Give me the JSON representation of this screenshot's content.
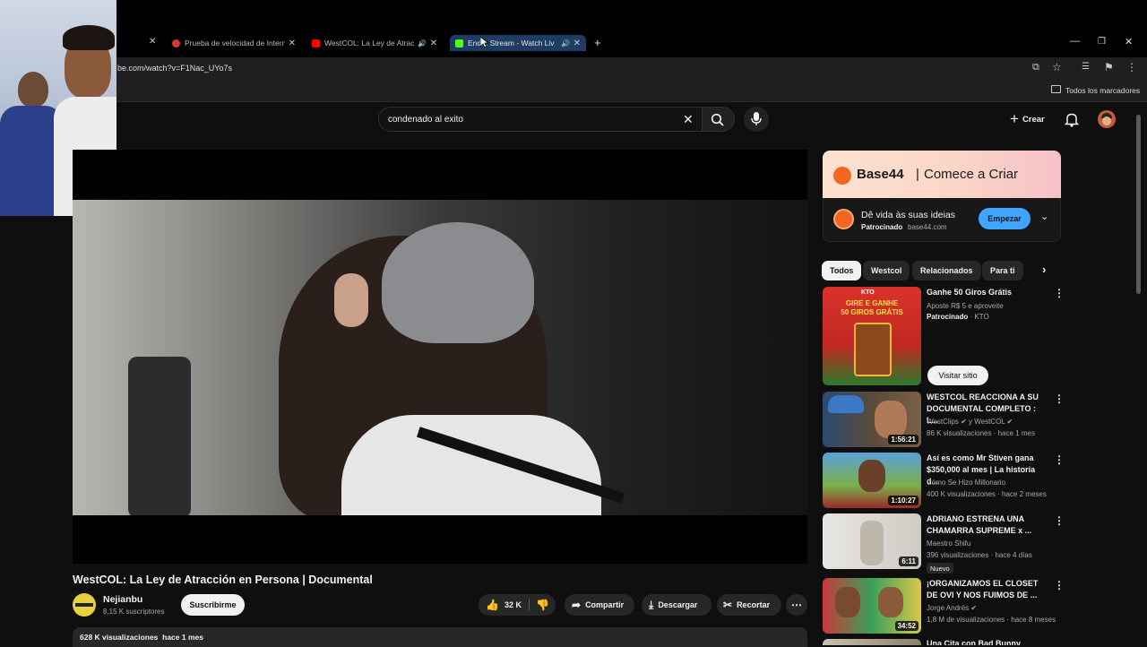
{
  "browser": {
    "tabs": [
      {
        "title": "Prueba de velocidad de Interne",
        "favicon_color": "#d93636"
      },
      {
        "title": "WestCOL: La Ley de Atracci",
        "favicon_color": "#ff0000"
      },
      {
        "title": "End... Stream - Watch Liv",
        "favicon_color": "#53fc18"
      }
    ],
    "new_tab_label": "+",
    "url": "be.com/watch?v=F1Nac_UYo7s",
    "bookmarks_label": "Todos los marcadores"
  },
  "header": {
    "search_value": "condenado al exito",
    "create_label": "Crear"
  },
  "video": {
    "title": "WestCOL: La Ley de Atracción en Persona | Documental",
    "channel": "Nejianbu",
    "subscribers": "8,15 K suscriptores",
    "subscribe_label": "Suscribirme",
    "likes": "32 K",
    "share_label": "Compartir",
    "download_label": "Descargar",
    "clip_label": "Recortar",
    "views_line": "628 K visualizaciones  hace 1 mes"
  },
  "ad": {
    "banner_text": "Base 44 | Comece a Criar",
    "brand": "Base44",
    "tagline": "Comece a Criar",
    "headline": "Dê vida às suas ideias",
    "sponsor_prefix": "Patrocinado",
    "domain": "base44.com",
    "cta": "Empezar",
    "accent": "#f26522"
  },
  "chips": [
    "Todos",
    "Westcol",
    "Relacionados",
    "Para ti"
  ],
  "sponsored": {
    "title": "Ganhe 50 Giros Grátis",
    "desc": "Aposte R$ 5 e aproveite",
    "sponsor_prefix": "Patrocinado",
    "advertiser": "KTO",
    "cta": "Visitar sitio",
    "thumb_text_1": "GIRE E GANHE",
    "thumb_text_2": "50 GIROS GRÁTIS",
    "thumb_logo": "KTO"
  },
  "recommendations": [
    {
      "title": "WESTCOL REACCIONA A SU DOCUMENTAL COMPLETO : L...",
      "channel": "WestClips ✔ y WestCOL ✔",
      "meta": "86 K visualizaciones · hace 1 mes",
      "duration": "1:56:21"
    },
    {
      "title": "Así es como Mr Stiven gana $350,000 al mes | La historia d...",
      "channel": "Cómo Se Hizo Millonario",
      "meta": "400 K visualizaciones · hace 2 meses",
      "duration": "1:10:27"
    },
    {
      "title": "ADRIANO ESTRENA UNA CHAMARRA SUPREME x ...",
      "channel": "Maestro Shifu",
      "meta": "396 visualizaciones · hace 4 días",
      "duration": "6:11",
      "badge": "Nuevo"
    },
    {
      "title": "¡ORGANIZAMOS EL CLOSET DE OVI Y NOS FUIMOS DE ...",
      "channel": "Jorge Andrés ✔",
      "meta": "1,8 M de visualizaciones · hace 8 meses",
      "duration": "34:52"
    },
    {
      "title": "Una Cita con Bad Bunny"
    }
  ]
}
